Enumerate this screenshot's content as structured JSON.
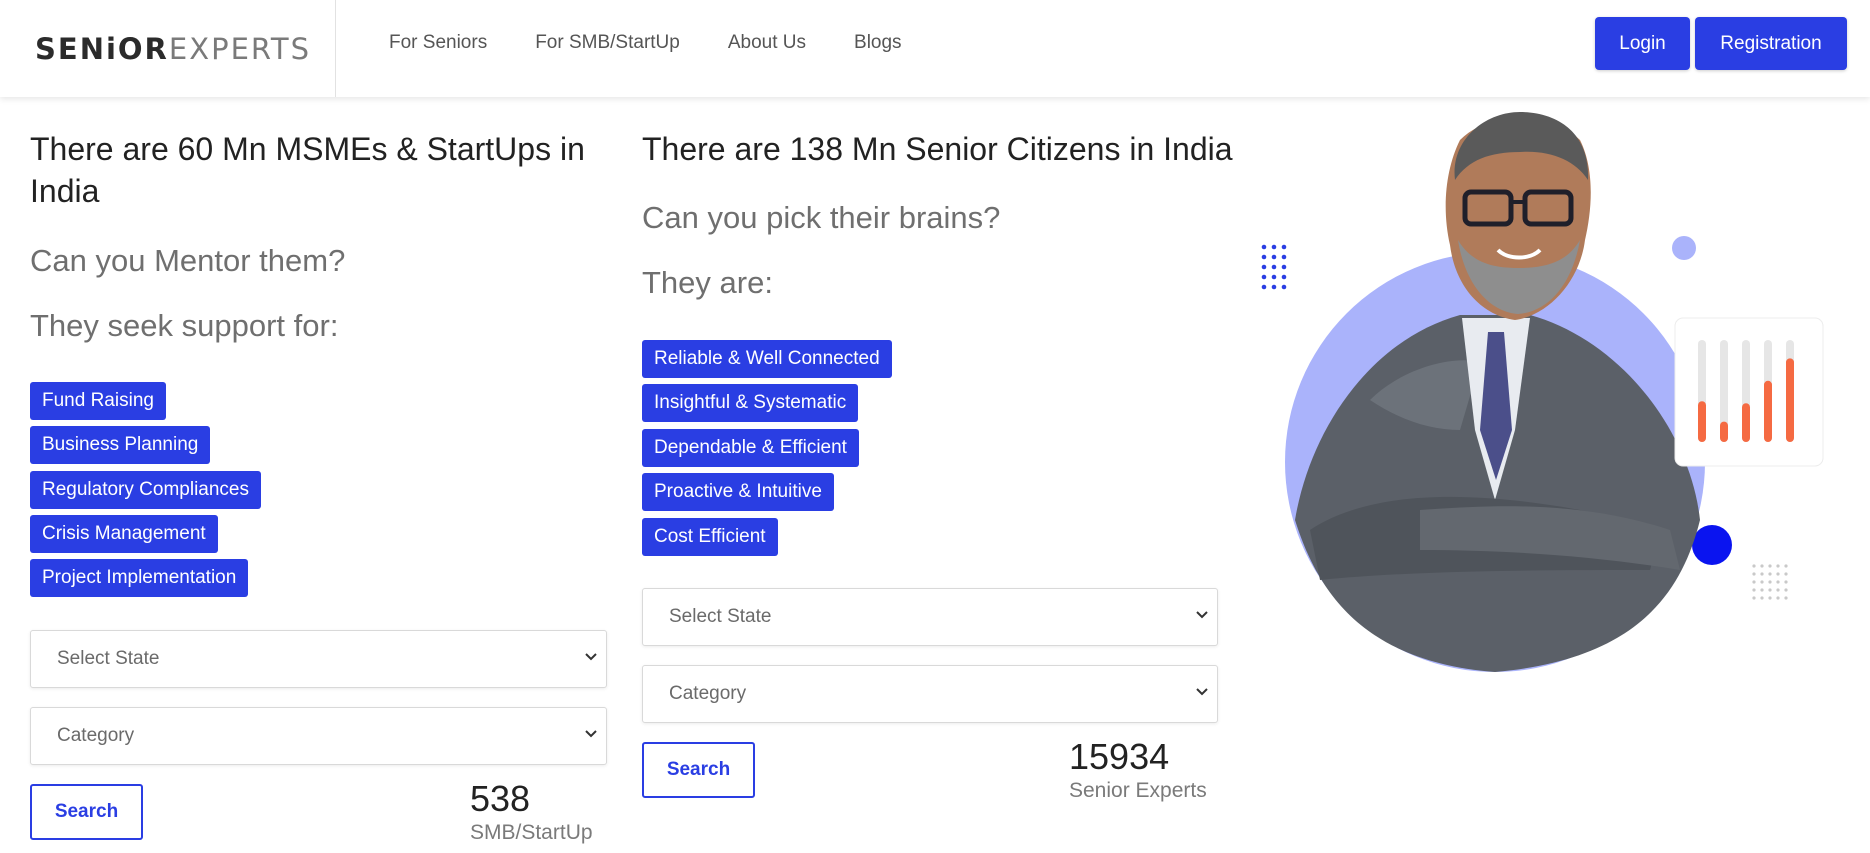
{
  "header": {
    "logo": {
      "part1": "SENiOR",
      "part2": "EXPERTS"
    },
    "nav": [
      "For Seniors",
      "For SMB/StartUp",
      "About Us",
      "Blogs"
    ],
    "login_label": "Login",
    "register_label": "Registration"
  },
  "smb_panel": {
    "headline": "There are 60 Mn MSMEs & StartUps in India",
    "question": "Can you Mentor them?",
    "subhead": "They seek support for:",
    "tags": [
      "Fund Raising",
      "Business Planning",
      "Regulatory Compliances",
      "Crisis Management",
      "Project Implementation"
    ],
    "state_select": "Select State",
    "category_select": "Category",
    "search_label": "Search",
    "count": "538",
    "count_label": "SMB/StartUp"
  },
  "senior_panel": {
    "headline": "There are 138 Mn Senior Citizens in India",
    "question": "Can you pick their brains?",
    "subhead": "They are:",
    "tags": [
      "Reliable & Well Connected",
      "Insightful & Systematic",
      "Dependable & Efficient",
      "Proactive & Intuitive",
      "Cost Efficient"
    ],
    "state_select": "Select State",
    "category_select": "Category",
    "search_label": "Search",
    "count": "15934",
    "count_label": "Senior Experts"
  },
  "colors": {
    "brand_blue": "#2a3ee3",
    "hero_circle": "#aab3fb",
    "chart_orange": "#f56a42"
  },
  "hero": {
    "image": "person-crossed-arms-photo",
    "decor": [
      "dot-grid-icon",
      "bar-chart-card-icon"
    ],
    "bar_levels": [
      0.4,
      0.2,
      0.38,
      0.6,
      0.82
    ]
  }
}
